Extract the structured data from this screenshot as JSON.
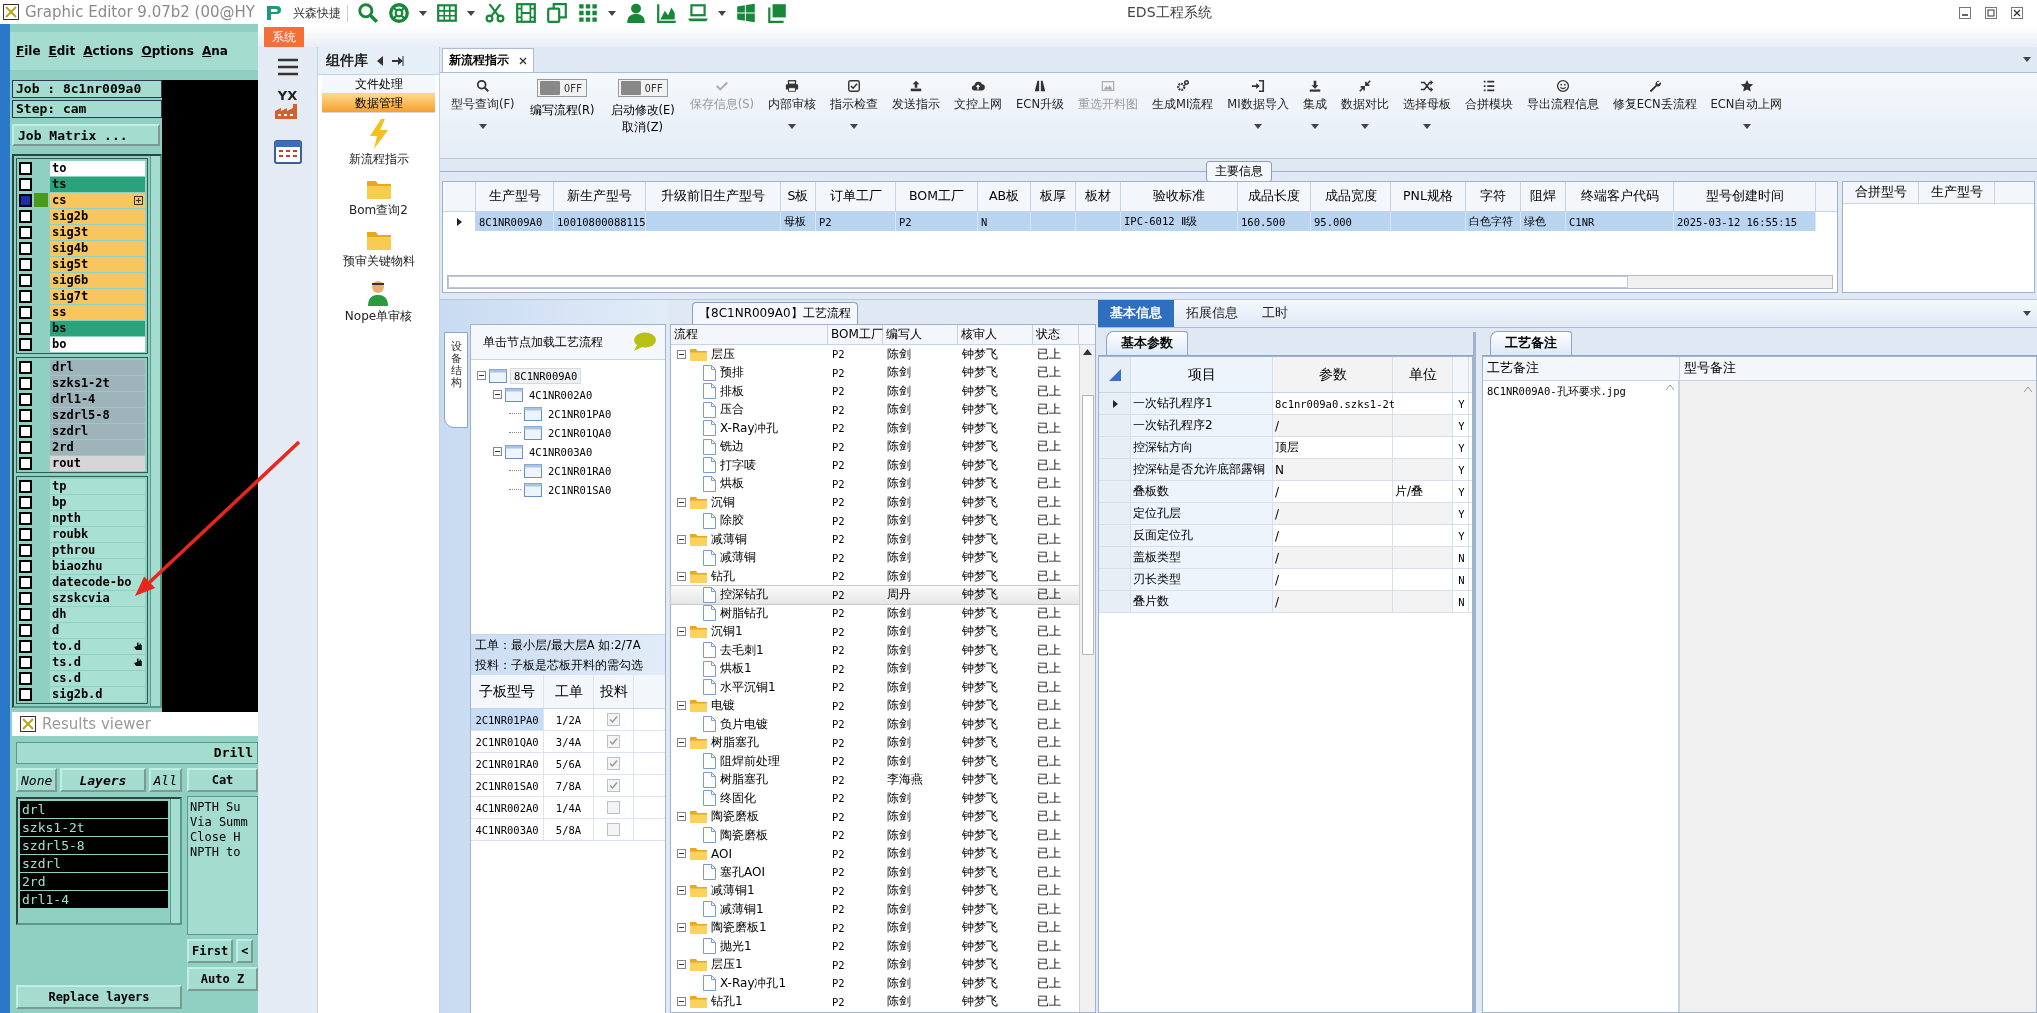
{
  "editor": {
    "title": "Graphic Editor 9.07b2 (00@HY",
    "menu": [
      "File",
      "Edit",
      "Actions",
      "Options",
      "Ana"
    ],
    "job": "Job : 8c1nr009a0",
    "step": "Step: cam",
    "matrix_button": "Job Matrix ...",
    "layer_groups": [
      [
        {
          "name": "to",
          "color": "#ffffff",
          "selected": false
        },
        {
          "name": "ts",
          "color": "#2aa37c",
          "selected": false
        },
        {
          "name": "cs",
          "color": "#f9c55e",
          "selected": true
        },
        {
          "name": "sig2b",
          "color": "#f9c55e",
          "selected": false
        },
        {
          "name": "sig3t",
          "color": "#f9c55e",
          "selected": false
        },
        {
          "name": "sig4b",
          "color": "#f9c55e",
          "selected": false
        },
        {
          "name": "sig5t",
          "color": "#f9c55e",
          "selected": false
        },
        {
          "name": "sig6b",
          "color": "#f9c55e",
          "selected": false
        },
        {
          "name": "sig7t",
          "color": "#f9c55e",
          "selected": false
        },
        {
          "name": "ss",
          "color": "#f9c55e",
          "selected": false
        },
        {
          "name": "bs",
          "color": "#2aa37c",
          "selected": false
        },
        {
          "name": "bo",
          "color": "#ffffff",
          "selected": false
        }
      ],
      [
        {
          "name": "drl",
          "color": "#9fb3bb",
          "selected": false
        },
        {
          "name": "szks1-2t",
          "color": "#9fb3bb",
          "selected": false
        },
        {
          "name": "drl1-4",
          "color": "#9fb3bb",
          "selected": false
        },
        {
          "name": "szdrl5-8",
          "color": "#9fb3bb",
          "selected": false
        },
        {
          "name": "szdrl",
          "color": "#9fb3bb",
          "selected": false
        },
        {
          "name": "2rd",
          "color": "#9fb3bb",
          "selected": false
        },
        {
          "name": "rout",
          "color": "#d6d6d6",
          "selected": false
        }
      ],
      [
        {
          "name": "tp",
          "color": "#a9e0d4",
          "selected": false
        },
        {
          "name": "bp",
          "color": "#a9e0d4",
          "selected": false
        },
        {
          "name": "npth",
          "color": "#a9e0d4",
          "selected": false
        },
        {
          "name": "roubk",
          "color": "#a9e0d4",
          "selected": false
        },
        {
          "name": "pthrou",
          "color": "#a9e0d4",
          "selected": false
        },
        {
          "name": "biaozhu",
          "color": "#a9e0d4",
          "selected": false
        },
        {
          "name": "datecode-bo",
          "color": "#a9e0d4",
          "selected": false
        },
        {
          "name": "szskcvia",
          "color": "#a9e0d4",
          "selected": false
        },
        {
          "name": "dh",
          "color": "#a9e0d4",
          "selected": false
        },
        {
          "name": "d",
          "color": "#a9e0d4",
          "selected": false
        },
        {
          "name": "to.d",
          "color": "#a9e0d4",
          "selected": false
        },
        {
          "name": "ts.d",
          "color": "#a9e0d4",
          "selected": false
        },
        {
          "name": "cs.d",
          "color": "#a9e0d4",
          "selected": false
        },
        {
          "name": "sig2b.d",
          "color": "#a9e0d4",
          "selected": false
        }
      ]
    ]
  },
  "results_viewer": {
    "title": "Results viewer",
    "header": "Drill",
    "filter_buttons": [
      {
        "label": "None",
        "selected": false
      },
      {
        "label": "Layers",
        "selected": true
      },
      {
        "label": "All",
        "selected": false
      }
    ],
    "layers": [
      "drl",
      "szks1-2t",
      "szdrl5-8",
      "szdrl",
      "2rd",
      "drl1-4"
    ],
    "category_header": "Cat",
    "summary_lines": [
      "NPTH Su",
      "Via Summ",
      "Close H",
      "NPTH to"
    ],
    "nav_buttons": [
      "First",
      "<"
    ],
    "zoom_button": "Auto Z",
    "replace_button": "Replace layers"
  },
  "app": {
    "quick_label": "兴森快捷",
    "title": "EDS工程系统",
    "menu_tab": "系统"
  },
  "sidebar": {
    "logo_label": "YX"
  },
  "component_library": {
    "title": "组件库",
    "groups": [
      {
        "label": "文件处理",
        "selected": false
      },
      {
        "label": "数据管理",
        "selected": true
      }
    ],
    "items": [
      {
        "label": "新流程指示"
      },
      {
        "label": "Bom查询2"
      },
      {
        "label": "预审关键物料"
      },
      {
        "label": "Nope单审核"
      }
    ]
  },
  "doc_tabs": [
    {
      "label": "新流程指示",
      "selected": true
    }
  ],
  "toolbar": [
    {
      "kind": "button",
      "label": "型号查询(F)",
      "dropdown": true,
      "disabled": false
    },
    {
      "kind": "toggle",
      "label": "编写流程(R)",
      "state": "OFF",
      "on": false
    },
    {
      "kind": "toggle",
      "label": "启动修改(E)",
      "sublabel": "取消(Z)",
      "state": "OFF",
      "on": false
    },
    {
      "kind": "button",
      "label": "保存信息(S)",
      "dropdown": false,
      "disabled": true
    },
    {
      "kind": "button",
      "label": "内部审核",
      "dropdown": true,
      "disabled": false
    },
    {
      "kind": "button",
      "label": "指示检查",
      "dropdown": true,
      "disabled": false
    },
    {
      "kind": "button",
      "label": "发送指示",
      "dropdown": false,
      "disabled": false
    },
    {
      "kind": "button",
      "label": "文控上网",
      "dropdown": false,
      "disabled": false
    },
    {
      "kind": "button",
      "label": "ECN升级",
      "dropdown": false,
      "disabled": false
    },
    {
      "kind": "button",
      "label": "重选开料图",
      "dropdown": false,
      "disabled": true
    },
    {
      "kind": "button",
      "label": "生成MI流程",
      "dropdown": false,
      "disabled": false
    },
    {
      "kind": "button",
      "label": "MI数据导入",
      "dropdown": true,
      "disabled": false
    },
    {
      "kind": "button",
      "label": "集成",
      "dropdown": true,
      "disabled": false
    },
    {
      "kind": "button",
      "label": "数据对比",
      "dropdown": true,
      "disabled": false
    },
    {
      "kind": "button",
      "label": "选择母板",
      "dropdown": true,
      "disabled": false
    },
    {
      "kind": "button",
      "label": "合拼模块",
      "dropdown": false,
      "disabled": false
    },
    {
      "kind": "button",
      "label": "导出流程信息",
      "dropdown": false,
      "disabled": false
    },
    {
      "kind": "button",
      "label": "修复ECN丢流程",
      "dropdown": false,
      "disabled": false
    },
    {
      "kind": "button",
      "label": "ECN自动上网",
      "dropdown": true,
      "disabled": false
    }
  ],
  "main_info": {
    "title": "主要信息",
    "columns": [
      "生产型号",
      "新生产型号",
      "升级前旧生产型号",
      "S板",
      "订单工厂",
      "BOM工厂",
      "AB板",
      "板厚",
      "板材",
      "验收标准",
      "成品长度",
      "成品宽度",
      "PNL规格",
      "字符",
      "阻焊",
      "终端客户代码",
      "型号创建时间"
    ],
    "rows": [
      {
        "selected": true,
        "cells": [
          "8C1NR009A0",
          "10010800088115",
          null,
          "母板",
          "P2",
          "P2",
          "N",
          null,
          null,
          "IPC-6012 Ⅱ级",
          "160.500",
          "95.000",
          null,
          "白色字符",
          "绿色",
          "C1NR",
          "2025-03-12 16:55:15"
        ]
      }
    ],
    "side_columns": [
      "合拼型号",
      "生产型号"
    ]
  },
  "structure": {
    "side_tab": "设备结构",
    "header": "单击节点加载工艺流程",
    "nodes": [
      {
        "label": "8C1NR009A0",
        "selected": true,
        "expanded": true,
        "children": [
          {
            "label": "4C1NR002A0",
            "selected": false,
            "expanded": true,
            "children": [
              {
                "label": "2C1NR01PA0",
                "selected": false
              },
              {
                "label": "2C1NR01QA0",
                "selected": false
              }
            ]
          },
          {
            "label": "4C1NR003A0",
            "selected": false,
            "expanded": true,
            "children": [
              {
                "label": "2C1NR01RA0",
                "selected": false
              },
              {
                "label": "2C1NR01SA0",
                "selected": false
              }
            ]
          }
        ]
      }
    ],
    "notes": [
      "工单：最小层/最大层A 如:2/7A",
      "投料：子板是芯板开料的需勾选"
    ],
    "boards": {
      "columns": [
        "子板型号",
        "工单",
        "投料"
      ],
      "rows": [
        {
          "model": "2C1NR01PA0",
          "order": "1/2A",
          "checked": true,
          "selected": true
        },
        {
          "model": "2C1NR01QA0",
          "order": "3/4A",
          "checked": true,
          "selected": false
        },
        {
          "model": "2C1NR01RA0",
          "order": "5/6A",
          "checked": true,
          "selected": false
        },
        {
          "model": "2C1NR01SA0",
          "order": "7/8A",
          "checked": true,
          "selected": false
        },
        {
          "model": "4C1NR002A0",
          "order": "1/4A",
          "checked": false,
          "selected": false
        },
        {
          "model": "4C1NR003A0",
          "order": "5/8A",
          "checked": false,
          "selected": false
        }
      ]
    }
  },
  "flow": {
    "title": "【8C1NR009A0】工艺流程",
    "columns": [
      "流程",
      "BOM工厂",
      "编写人",
      "核审人",
      "状态"
    ],
    "groups": [
      {
        "name": "层压",
        "factory": "P2",
        "writer": "陈剑",
        "reviewer": "钟梦飞",
        "status": "已上",
        "expanded": true,
        "selected": false,
        "steps": [
          {
            "name": "预排",
            "factory": "P2",
            "writer": "陈剑",
            "reviewer": "钟梦飞",
            "status": "已上",
            "selected": false
          },
          {
            "name": "排板",
            "factory": "P2",
            "writer": "陈剑",
            "reviewer": "钟梦飞",
            "status": "已上",
            "selected": false
          },
          {
            "name": "压合",
            "factory": "P2",
            "writer": "陈剑",
            "reviewer": "钟梦飞",
            "status": "已上",
            "selected": false
          },
          {
            "name": "X-Ray冲孔",
            "factory": "P2",
            "writer": "陈剑",
            "reviewer": "钟梦飞",
            "status": "已上",
            "selected": false
          },
          {
            "name": "铣边",
            "factory": "P2",
            "writer": "陈剑",
            "reviewer": "钟梦飞",
            "status": "已上",
            "selected": false
          },
          {
            "name": "打字唛",
            "factory": "P2",
            "writer": "陈剑",
            "reviewer": "钟梦飞",
            "status": "已上",
            "selected": false
          },
          {
            "name": "烘板",
            "factory": "P2",
            "writer": "陈剑",
            "reviewer": "钟梦飞",
            "status": "已上",
            "selected": false
          }
        ]
      },
      {
        "name": "沉铜",
        "factory": "P2",
        "writer": "陈剑",
        "reviewer": "钟梦飞",
        "status": "已上",
        "expanded": true,
        "selected": false,
        "steps": [
          {
            "name": "除胶",
            "factory": "P2",
            "writer": "陈剑",
            "reviewer": "钟梦飞",
            "status": "已上",
            "selected": false
          }
        ]
      },
      {
        "name": "减薄铜",
        "factory": "P2",
        "writer": "陈剑",
        "reviewer": "钟梦飞",
        "status": "已上",
        "expanded": true,
        "selected": false,
        "steps": [
          {
            "name": "减薄铜",
            "factory": "P2",
            "writer": "陈剑",
            "reviewer": "钟梦飞",
            "status": "已上",
            "selected": false
          }
        ]
      },
      {
        "name": "钻孔",
        "factory": "P2",
        "writer": "陈剑",
        "reviewer": "钟梦飞",
        "status": "已上",
        "expanded": true,
        "selected": false,
        "steps": [
          {
            "name": "控深钻孔",
            "factory": "P2",
            "writer": "周丹",
            "reviewer": "钟梦飞",
            "status": "已上",
            "selected": true
          },
          {
            "name": "树脂钻孔",
            "factory": "P2",
            "writer": "陈剑",
            "reviewer": "钟梦飞",
            "status": "已上",
            "selected": false
          }
        ]
      },
      {
        "name": "沉铜1",
        "factory": "P2",
        "writer": "陈剑",
        "reviewer": "钟梦飞",
        "status": "已上",
        "expanded": true,
        "selected": false,
        "steps": [
          {
            "name": "去毛刺1",
            "factory": "P2",
            "writer": "陈剑",
            "reviewer": "钟梦飞",
            "status": "已上",
            "selected": false
          },
          {
            "name": "烘板1",
            "factory": "P2",
            "writer": "陈剑",
            "reviewer": "钟梦飞",
            "status": "已上",
            "selected": false
          },
          {
            "name": "水平沉铜1",
            "factory": "P2",
            "writer": "陈剑",
            "reviewer": "钟梦飞",
            "status": "已上",
            "selected": false
          }
        ]
      },
      {
        "name": "电镀",
        "factory": "P2",
        "writer": "陈剑",
        "reviewer": "钟梦飞",
        "status": "已上",
        "expanded": true,
        "selected": false,
        "steps": [
          {
            "name": "负片电镀",
            "factory": "P2",
            "writer": "陈剑",
            "reviewer": "钟梦飞",
            "status": "已上",
            "selected": false
          }
        ]
      },
      {
        "name": "树脂塞孔",
        "factory": "P2",
        "writer": "陈剑",
        "reviewer": "钟梦飞",
        "status": "已上",
        "expanded": true,
        "selected": false,
        "steps": [
          {
            "name": "阻焊前处理",
            "factory": "P2",
            "writer": "陈剑",
            "reviewer": "钟梦飞",
            "status": "已上",
            "selected": false
          },
          {
            "name": "树脂塞孔",
            "factory": "P2",
            "writer": "李海燕",
            "reviewer": "钟梦飞",
            "status": "已上",
            "selected": false
          },
          {
            "name": "终固化",
            "factory": "P2",
            "writer": "陈剑",
            "reviewer": "钟梦飞",
            "status": "已上",
            "selected": false
          }
        ]
      },
      {
        "name": "陶瓷磨板",
        "factory": "P2",
        "writer": "陈剑",
        "reviewer": "钟梦飞",
        "status": "已上",
        "expanded": true,
        "selected": false,
        "steps": [
          {
            "name": "陶瓷磨板",
            "factory": "P2",
            "writer": "陈剑",
            "reviewer": "钟梦飞",
            "status": "已上",
            "selected": false
          }
        ]
      },
      {
        "name": "AOI",
        "factory": "P2",
        "writer": "陈剑",
        "reviewer": "钟梦飞",
        "status": "已上",
        "expanded": true,
        "selected": false,
        "steps": [
          {
            "name": "塞孔AOI",
            "factory": "P2",
            "writer": "陈剑",
            "reviewer": "钟梦飞",
            "status": "已上",
            "selected": false
          }
        ]
      },
      {
        "name": "减薄铜1",
        "factory": "P2",
        "writer": "陈剑",
        "reviewer": "钟梦飞",
        "status": "已上",
        "expanded": true,
        "selected": false,
        "steps": [
          {
            "name": "减薄铜1",
            "factory": "P2",
            "writer": "陈剑",
            "reviewer": "钟梦飞",
            "status": "已上",
            "selected": false
          }
        ]
      },
      {
        "name": "陶瓷磨板1",
        "factory": "P2",
        "writer": "陈剑",
        "reviewer": "钟梦飞",
        "status": "已上",
        "expanded": true,
        "selected": false,
        "steps": [
          {
            "name": "抛光1",
            "factory": "P2",
            "writer": "陈剑",
            "reviewer": "钟梦飞",
            "status": "已上",
            "selected": false
          }
        ]
      },
      {
        "name": "层压1",
        "factory": "P2",
        "writer": "陈剑",
        "reviewer": "钟梦飞",
        "status": "已上",
        "expanded": true,
        "selected": false,
        "steps": [
          {
            "name": "X-Ray冲孔1",
            "factory": "P2",
            "writer": "陈剑",
            "reviewer": "钟梦飞",
            "status": "已上",
            "selected": false
          }
        ]
      },
      {
        "name": "钻孔1",
        "factory": "P2",
        "writer": "陈剑",
        "reviewer": "钟梦飞",
        "status": "已上",
        "expanded": true,
        "selected": false
      }
    ]
  },
  "details": {
    "tabs": [
      {
        "label": "基本信息",
        "selected": true
      },
      {
        "label": "拓展信息",
        "selected": false
      },
      {
        "label": "工时",
        "selected": false
      }
    ],
    "basic": {
      "tab": "基本参数",
      "columns": [
        "项目",
        "参数",
        "单位"
      ],
      "rows": [
        {
          "item": "一次钻孔程序1",
          "value": "8c1nr009a0.szks1-2t",
          "flag": "Y",
          "current": true
        },
        {
          "item": "一次钻孔程序2",
          "value": "/",
          "flag": "Y",
          "current": false
        },
        {
          "item": "控深钻方向",
          "value": "顶层",
          "flag": "Y",
          "current": false
        },
        {
          "item": "控深钻是否允许底部露铜",
          "value": "N",
          "flag": "Y",
          "current": false
        },
        {
          "item": "叠板数",
          "value": "/",
          "unit": "片/叠",
          "flag": "Y",
          "current": false
        },
        {
          "item": "定位孔层",
          "value": "/",
          "flag": "Y",
          "current": false
        },
        {
          "item": "反面定位孔",
          "value": "/",
          "flag": "Y",
          "current": false
        },
        {
          "item": "盖板类型",
          "value": "/",
          "flag": "N",
          "current": false
        },
        {
          "item": "刃长类型",
          "value": "/",
          "flag": "N",
          "current": false
        },
        {
          "item": "叠片数",
          "value": "/",
          "flag": "N",
          "current": false
        }
      ]
    },
    "notes": {
      "tab": "工艺备注",
      "columns": [
        "工艺备注",
        "型号备注"
      ],
      "process_note": "8C1NR009A0-孔环要求.jpg"
    }
  }
}
